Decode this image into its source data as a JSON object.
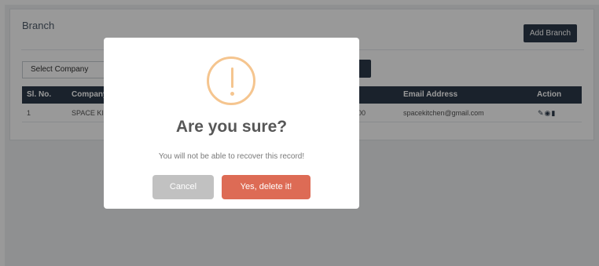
{
  "panel": {
    "title": "Branch",
    "add_button": "Add Branch",
    "company_select": {
      "selected": "Select Company"
    }
  },
  "table": {
    "columns": [
      "Sl. No.",
      "Company",
      "Email Address",
      "Action"
    ],
    "rows": [
      {
        "sl_no": "1",
        "company": "SPACE KI",
        "phone_fragment": "00",
        "email": "spacekitchen@gmail.com",
        "actions": [
          "edit-icon",
          "view-icon",
          "delete-icon"
        ]
      }
    ]
  },
  "modal": {
    "icon": "warning-icon",
    "title": "Are you sure?",
    "text": "You will not be able to recover this record!",
    "cancel_label": "Cancel",
    "confirm_label": "Yes, delete it!"
  },
  "colors": {
    "header_dark": "#2c3a4a",
    "warning": "#f5c58f",
    "confirm": "#dd6b55",
    "cancel": "#c1c1c1"
  }
}
